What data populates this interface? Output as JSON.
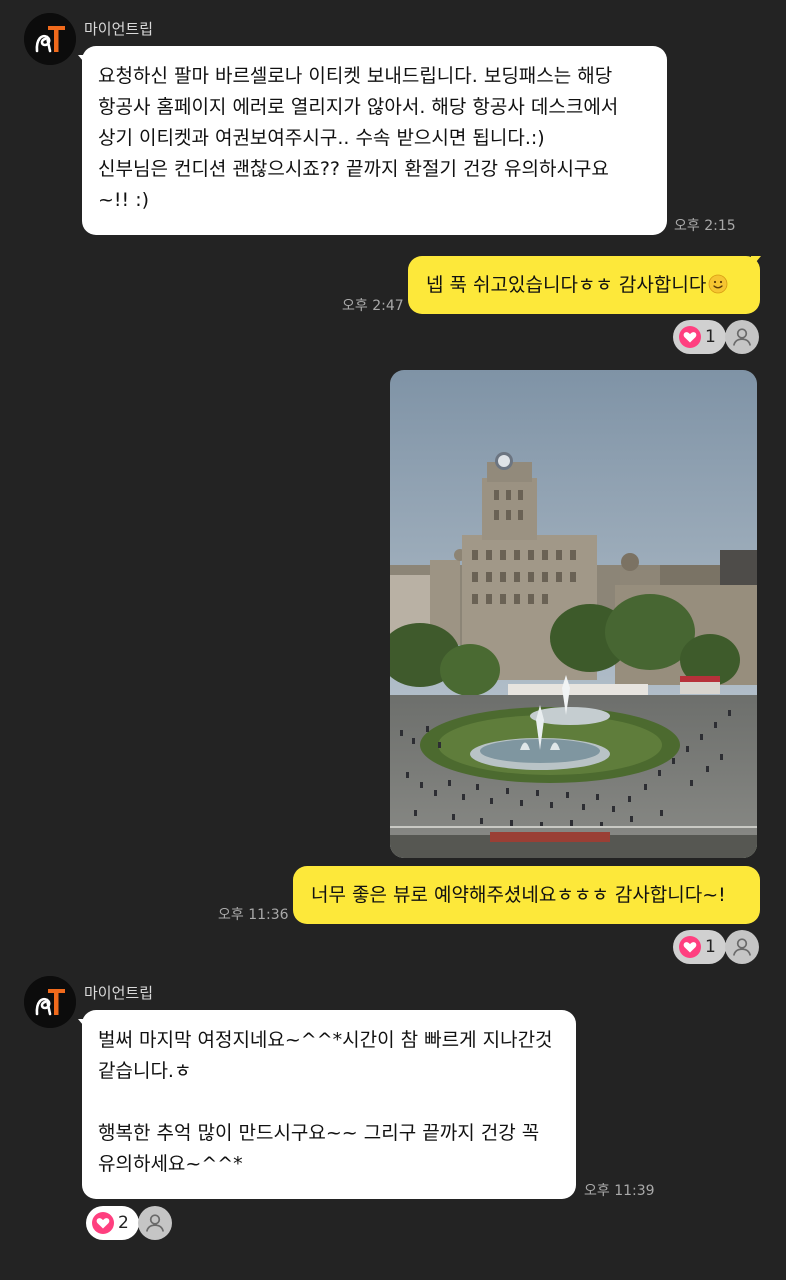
{
  "sender_name": "마이언트립",
  "messages": [
    {
      "lines": [
        "요청하신 팔마 바르셀로나 이티켓 보내드립니다. 보딩패스는 해당",
        "항공사 홈페이지 에러로 열리지가 않아서. 해당 항공사 데스크에서",
        "상기 이티켓과 여권보여주시구.. 수속 받으시면 됩니다.:)",
        "신부님은 컨디션 괜찮으시죠?? 끝까지 환절기 건강 유의하시구요",
        "~!! :)"
      ],
      "time": "오후 2:15"
    },
    {
      "text": "넵 푹 쉬고있습니다ㅎㅎ 감사합니다",
      "emoji": "smile-emoji",
      "time": "오후 2:47",
      "reaction_count": "1"
    },
    {
      "type": "photo",
      "image": "city-square-fountain-photo"
    },
    {
      "text": "너무 좋은 뷰로 예약해주셨네요ㅎㅎㅎ 감사합니다~!",
      "time": "오후 11:36",
      "reaction_count": "1"
    },
    {
      "lines": [
        "벌써 마지막 여정지네요~^^*시간이 참 빠르게 지나간것",
        "같습니다.ㅎ",
        "",
        "행복한 추억 많이 만드시구요~~ 그리구 끝까지 건강 꼭",
        "유의하세요~^^*"
      ],
      "time": "오후 11:39",
      "reaction_count": "2"
    }
  ],
  "icons": {
    "avatar": "myantrip-logo",
    "reaction": "heart-icon",
    "reactor": "user-icon"
  },
  "colors": {
    "background": "#232323",
    "incoming_bubble": "#ffffff",
    "outgoing_bubble": "#fde83a",
    "heart": "#ff3f7f",
    "logo_accent": "#f06a1c"
  }
}
